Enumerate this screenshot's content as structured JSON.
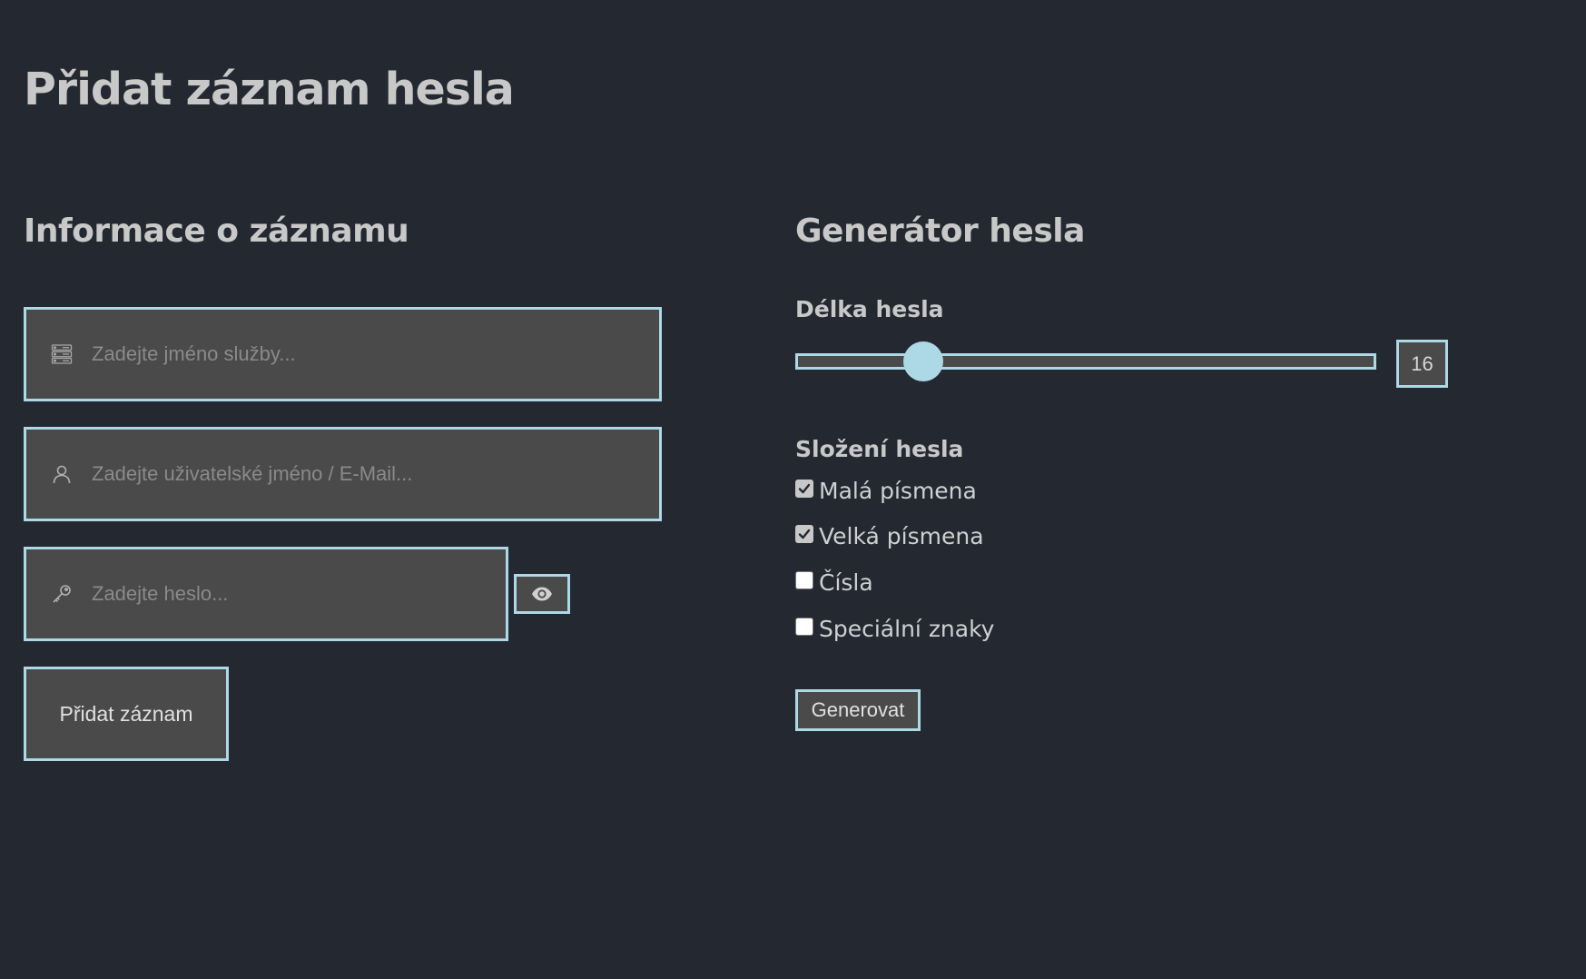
{
  "page": {
    "title": "Přidat záznam hesla"
  },
  "entry": {
    "section_title": "Informace o záznamu",
    "service": {
      "placeholder": "Zadejte jméno služby...",
      "value": "",
      "icon": "server-icon"
    },
    "username": {
      "placeholder": "Zadejte uživatelské jméno / E-Mail...",
      "value": "",
      "icon": "user-icon"
    },
    "password": {
      "placeholder": "Zadejte heslo...",
      "value": "",
      "icon": "key-icon"
    },
    "toggle_visibility_icon": "eye-icon",
    "add_button_label": "Přidat záznam"
  },
  "generator": {
    "section_title": "Generátor hesla",
    "length_label": "Délka hesla",
    "length_value": "16",
    "length_fraction": 0.22,
    "composition_label": "Složení hesla",
    "options": [
      {
        "label": "Malá písmena",
        "checked": true
      },
      {
        "label": "Velká písmena",
        "checked": true
      },
      {
        "label": "Čísla",
        "checked": false
      },
      {
        "label": "Speciální znaky",
        "checked": false
      }
    ],
    "generate_button_label": "Generovat"
  },
  "colors": {
    "background": "#242831",
    "accent": "#add8e6",
    "field_bg": "#4a4a4a",
    "text": "#c8c8c8"
  }
}
